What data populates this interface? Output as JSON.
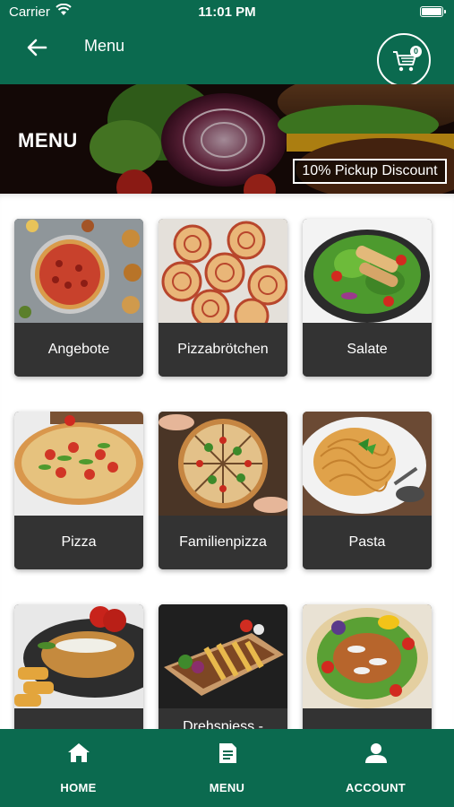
{
  "status_bar": {
    "carrier": "Carrier",
    "time": "11:01 PM"
  },
  "app_bar": {
    "title": "Menu",
    "cart_count": "0"
  },
  "banner": {
    "heading": "MENU",
    "discount": "10% Pickup Discount"
  },
  "categories": [
    {
      "label": "Angebote",
      "image": "pizza-spread"
    },
    {
      "label": "Pizzabrötchen",
      "image": "pizza-rolls"
    },
    {
      "label": "Salate",
      "image": "chicken-salad"
    },
    {
      "label": "Pizza",
      "image": "pizza"
    },
    {
      "label": "Familienpizza",
      "image": "family-pizza"
    },
    {
      "label": "Pasta",
      "image": "spaghetti"
    },
    {
      "label": "",
      "image": "schnitzel"
    },
    {
      "label": "Drehspiess -",
      "image": "doner-fries"
    },
    {
      "label": "",
      "image": "wrap-salad"
    }
  ],
  "tab_bar": {
    "home": "HOME",
    "menu": "MENU",
    "account": "ACCOUNT"
  },
  "colors": {
    "primary": "#0b6a4f",
    "card": "#333333",
    "text_light": "#ffffff"
  },
  "icons": [
    "back-arrow-icon",
    "cart-icon",
    "home-icon",
    "menu-list-icon",
    "account-icon"
  ]
}
